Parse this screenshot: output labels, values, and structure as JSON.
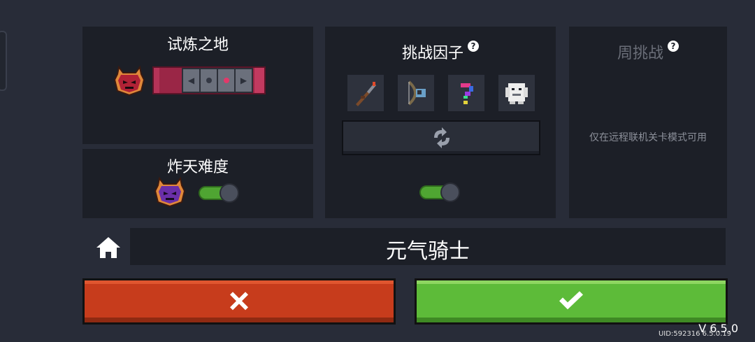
{
  "trial": {
    "title": "试炼之地",
    "emblem_icon": "red-demon-emblem-icon",
    "slider_icons": [
      "chevron-left-icon",
      "dot-icon",
      "dot-icon",
      "chevron-right-icon"
    ]
  },
  "hell": {
    "title": "炸天难度",
    "emblem_icon": "purple-demon-emblem-icon",
    "toggle_on": true
  },
  "challenge": {
    "title": "挑战因子",
    "help_symbol": "?",
    "factors": [
      "shotgun-icon",
      "bow-icon",
      "mystery-question-icon",
      "snow-ape-boss-icon"
    ],
    "refresh_icon": "refresh-icon",
    "toggle_on": true
  },
  "weekly": {
    "title": "周挑战",
    "help_symbol": "?",
    "note": "仅在远程联机关卡模式可用"
  },
  "name_bar": {
    "home_icon": "home-icon",
    "name": "元气骑士"
  },
  "buttons": {
    "cancel_icon": "close-icon",
    "confirm_icon": "check-icon",
    "cancel_color": "#c73c1c",
    "confirm_color": "#5dbb39"
  },
  "footer": {
    "version": "V 6.5.0",
    "uid": "UID:592316 6.5.0.19"
  }
}
